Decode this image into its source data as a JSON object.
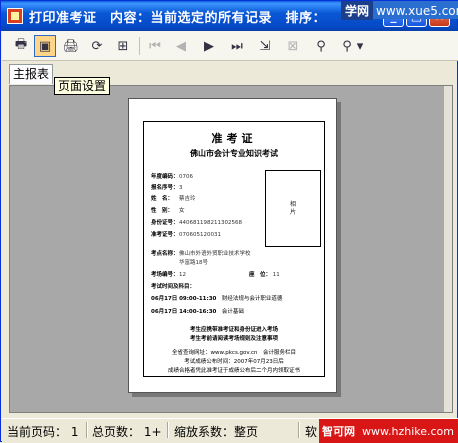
{
  "window": {
    "title": "打印准考证　内容：当前选定的所有记录　排序：",
    "controls": {
      "minimize": "_",
      "maximize": "□",
      "close": "×"
    }
  },
  "watermark_top": {
    "brand": "学网",
    "url": "www.xue5.com"
  },
  "toolbar": {
    "items": [
      {
        "name": "print-icon",
        "glyph": "🖶"
      },
      {
        "name": "page-setup-icon",
        "glyph": "▣"
      },
      {
        "name": "printer-icon",
        "glyph": "🖨"
      },
      {
        "name": "refresh-icon",
        "glyph": "⟳"
      },
      {
        "name": "tree-icon",
        "glyph": "⊞"
      },
      {
        "name": "first-page-icon",
        "glyph": "⏮"
      },
      {
        "name": "previous-page-icon",
        "glyph": "◀"
      },
      {
        "name": "next-page-icon",
        "glyph": "▶"
      },
      {
        "name": "last-page-icon",
        "glyph": "⏭"
      },
      {
        "name": "export-icon",
        "glyph": "⇲"
      },
      {
        "name": "stop-icon",
        "glyph": "⊠"
      },
      {
        "name": "find-icon",
        "glyph": "⚲"
      },
      {
        "name": "zoom-icon",
        "glyph": "⚲"
      },
      {
        "name": "zoom-dropdown-icon",
        "glyph": "▾"
      }
    ]
  },
  "tabs": {
    "main_report": "主报表"
  },
  "tooltip": "页面设置",
  "ticket": {
    "title": "准考证",
    "subtitle": "佛山市会计专业知识考试",
    "fields": [
      {
        "label": "年度编码：",
        "value": "0706"
      },
      {
        "label": "报名序号：",
        "value": "3"
      },
      {
        "label": "姓　名：",
        "value": "蔡吉玲"
      },
      {
        "label": "性　别：",
        "value": "女"
      },
      {
        "label": "身份证号：",
        "value": "440681198211302568"
      },
      {
        "label": "准考证号：",
        "value": "070605120031"
      }
    ],
    "photo_label": "相\n片",
    "venue_label": "考点名称：",
    "venue_value": "佛山市外语外贸职业技术学校",
    "venue_value2": "华富路18号",
    "room_label": "考场编号：",
    "room_value": "12",
    "seat_label": "座　位：",
    "seat_value": "11",
    "schedule_label": "考试时间及科目：",
    "exams": [
      {
        "date": "06月17日",
        "time": "09:00-11:30",
        "subject": "财经法规与会计职业道德"
      },
      {
        "date": "06月17日",
        "time": "14:00-16:30",
        "subject": "会计基础"
      }
    ],
    "notice1": "考生应携带准考证和身份证进入考场",
    "notice2": "考生考前请阅读考场规则及注意事项",
    "footer1": "全省查询网址：www.pkcs.gov.cn　会计服务栏目",
    "footer2": "考试成绩公布时间：2007年07月23日后",
    "footer3": "成绩合格者凭此准考证于成绩公布后二个月内领取证书"
  },
  "status": {
    "current_page": "当前页码： 1",
    "total_pages": "总页数： 1+",
    "zoom": "缩放系数：整页",
    "tail": "软"
  },
  "watermark_bottom": {
    "brand": "智可网",
    "url": "www.hzhike.com"
  }
}
